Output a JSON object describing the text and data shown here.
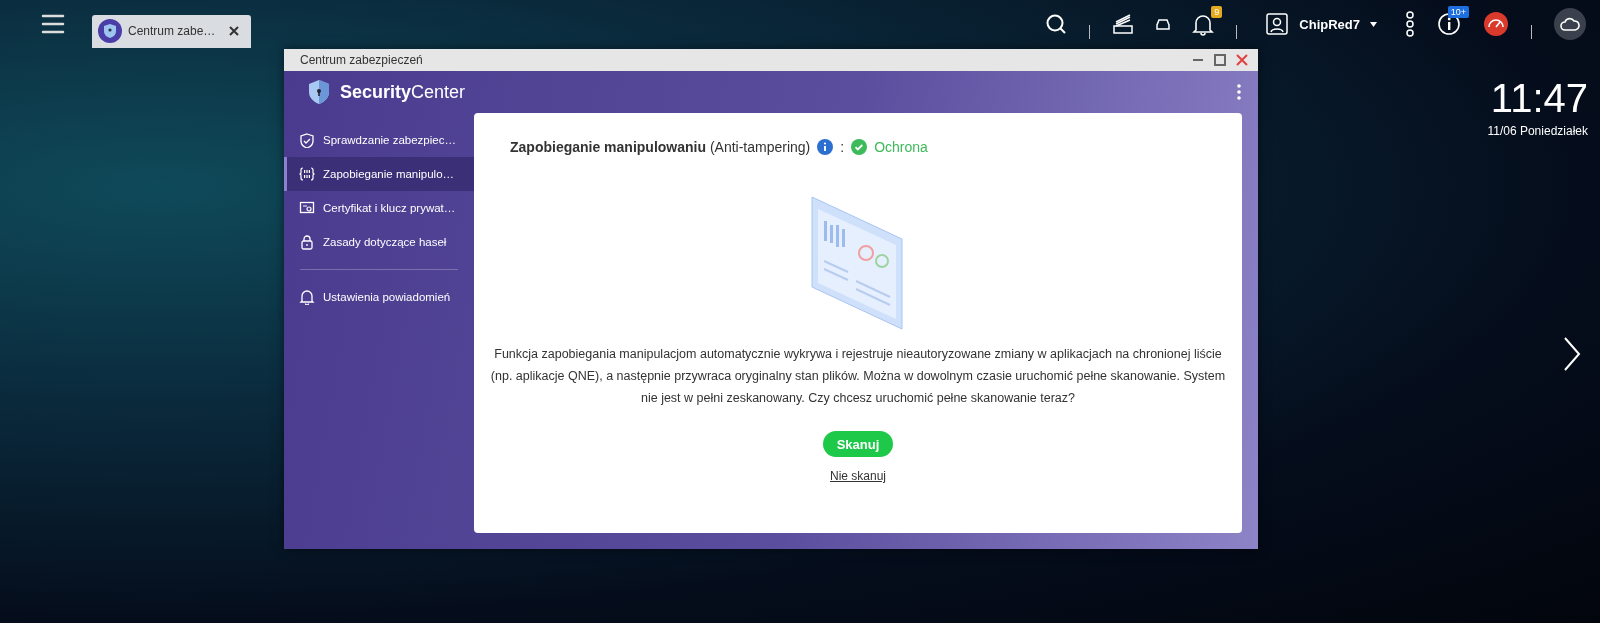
{
  "taskbar": {
    "tab": {
      "title": "Centrum zabe…",
      "selected": true
    }
  },
  "top_bar": {
    "notification_count": "9",
    "user": "ChipRed7",
    "info_count": "10+"
  },
  "clock": {
    "time": "11:47",
    "date": "11/06 Poniedziałek"
  },
  "window": {
    "title": "Centrum zabezpieczeń",
    "app_name": "**Security**Center"
  },
  "sidebar": {
    "groups": [
      [
        {
          "label": "Sprawdzanie zabezpiec…",
          "selected": false
        },
        {
          "label": "Zapobieganie manipulo…",
          "selected": true
        },
        {
          "label": "Certyfikat i klucz prywat…",
          "selected": false
        },
        {
          "label": "Zasady dotyczące haseł",
          "selected": false
        }
      ],
      [
        {
          "label": "Ustawienia powiadomień",
          "selected": false
        }
      ]
    ]
  },
  "content": {
    "title": "**Zapobieganie manipulowaniu** (Anti-tampering)",
    "separator": ":",
    "status": "Ochrona",
    "description": "Funkcja zapobiegania manipulacjom automatycznie wykrywa i rejestruje nieautoryzowane zmiany w aplikacjach na chronionej liście (np. aplikacje QNE), a następnie przywraca oryginalny stan plików. Można w dowolnym czasie uruchomić pełne skanowanie. System nie jest w pełni zeskanowany. Czy chcesz uruchomić pełne skanowanie teraz?",
    "primary_button": "Skanuj",
    "link": "Nie skanuj"
  }
}
